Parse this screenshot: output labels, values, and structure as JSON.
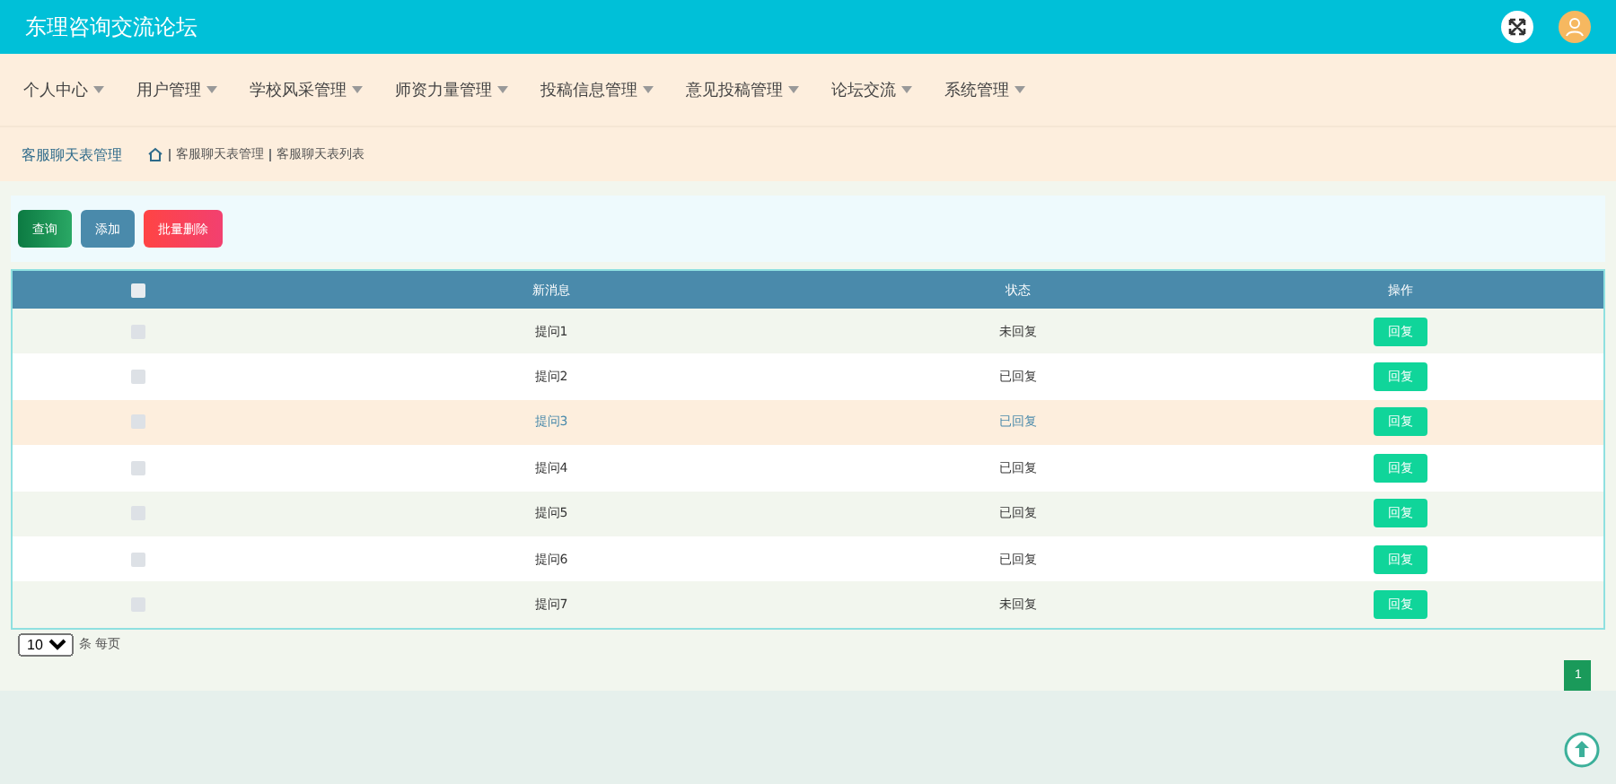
{
  "header": {
    "title": "东理咨询交流论坛"
  },
  "nav": [
    {
      "label": "个人中心"
    },
    {
      "label": "用户管理"
    },
    {
      "label": "学校风采管理"
    },
    {
      "label": "师资力量管理"
    },
    {
      "label": "投稿信息管理"
    },
    {
      "label": "意见投稿管理"
    },
    {
      "label": "论坛交流"
    },
    {
      "label": "系统管理"
    }
  ],
  "breadcrumb": {
    "title": "客服聊天表管理",
    "path": [
      "客服聊天表管理",
      "客服聊天表列表"
    ]
  },
  "toolbar": [
    {
      "label": "查询",
      "kind": "search"
    },
    {
      "label": "添加",
      "kind": "add"
    },
    {
      "label": "批量删除",
      "kind": "delete"
    }
  ],
  "table": {
    "header_checked": false,
    "columns": [
      "新消息",
      "状态",
      "操作"
    ],
    "rows": [
      {
        "checked": false,
        "hovered": false,
        "message": "提问1",
        "status": "未回复",
        "action": "回复"
      },
      {
        "checked": false,
        "hovered": false,
        "message": "提问2",
        "status": "已回复",
        "action": "回复"
      },
      {
        "checked": false,
        "hovered": true,
        "message": "提问3",
        "status": "已回复",
        "action": "回复"
      },
      {
        "checked": false,
        "hovered": false,
        "message": "提问4",
        "status": "已回复",
        "action": "回复"
      },
      {
        "checked": false,
        "hovered": false,
        "message": "提问5",
        "status": "已回复",
        "action": "回复"
      },
      {
        "checked": false,
        "hovered": false,
        "message": "提问6",
        "status": "已回复",
        "action": "回复"
      },
      {
        "checked": false,
        "hovered": false,
        "message": "提问7",
        "status": "未回复",
        "action": "回复"
      }
    ]
  },
  "pagination": {
    "page_size": "10",
    "per_page_label": "条 每页",
    "pages": [
      {
        "label": "1",
        "selected": true
      }
    ]
  }
}
